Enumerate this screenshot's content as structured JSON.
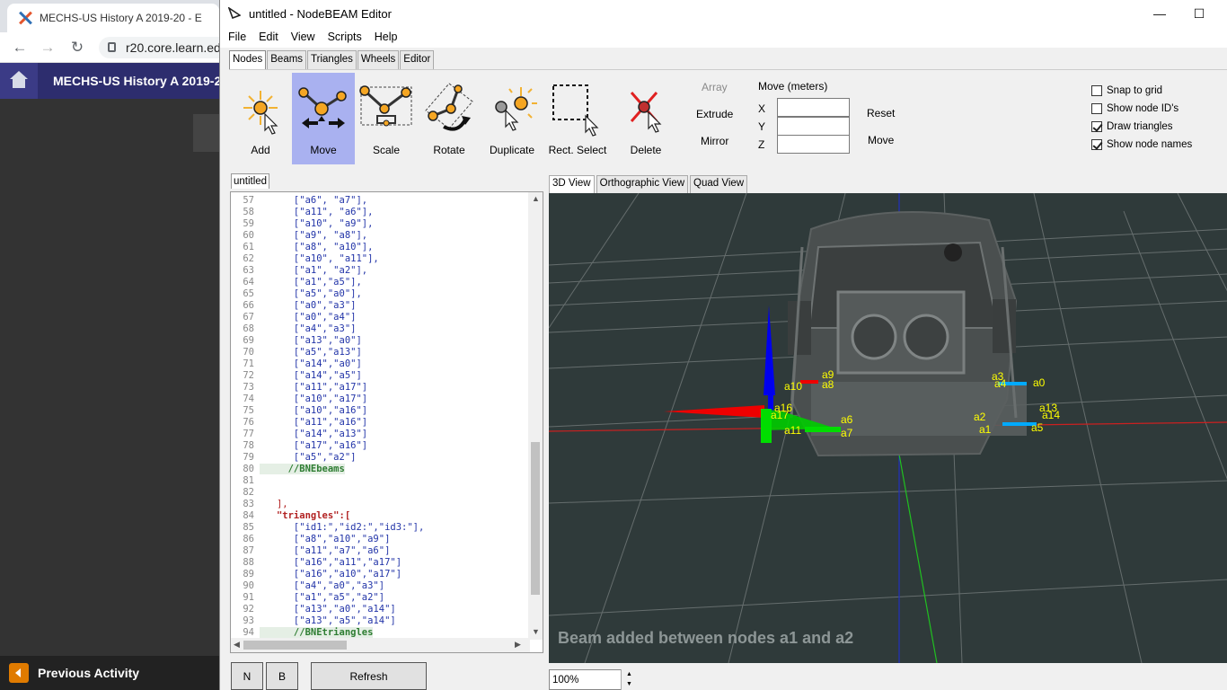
{
  "browser": {
    "tab_title": "MECHS-US History A 2019-20 - E",
    "url": "r20.core.learn.ed",
    "site_title": "MECHS-US History A 2019-20",
    "prev_activity": "Previous Activity"
  },
  "window": {
    "title": "untitled - NodeBEAM Editor",
    "minimize": "—",
    "maximize": "☐"
  },
  "menu": [
    "File",
    "Edit",
    "View",
    "Scripts",
    "Help"
  ],
  "tabs": [
    "Nodes",
    "Beams",
    "Triangles",
    "Wheels",
    "Editor"
  ],
  "tools": [
    {
      "label": "Add",
      "icon": "add-node-icon"
    },
    {
      "label": "Move",
      "icon": "move-node-icon"
    },
    {
      "label": "Scale",
      "icon": "scale-node-icon"
    },
    {
      "label": "Rotate",
      "icon": "rotate-node-icon"
    },
    {
      "label": "Duplicate",
      "icon": "duplicate-node-icon"
    },
    {
      "label": "Rect. Select",
      "icon": "rect-select-icon"
    },
    {
      "label": "Delete",
      "icon": "delete-node-icon"
    }
  ],
  "side_actions": {
    "array": "Array",
    "extrude": "Extrude",
    "mirror": "Mirror"
  },
  "move_panel": {
    "title": "Move (meters)",
    "x_label": "X",
    "y_label": "Y",
    "z_label": "Z",
    "reset": "Reset",
    "move": "Move",
    "x_value": "",
    "y_value": "",
    "z_value": ""
  },
  "options": [
    {
      "label": "Snap to grid",
      "checked": false
    },
    {
      "label": "Show node ID's",
      "checked": false
    },
    {
      "label": "Draw triangles",
      "checked": true
    },
    {
      "label": "Show node names",
      "checked": true
    }
  ],
  "code_tab": "untitled",
  "code_lines": [
    {
      "n": "57",
      "text": "      [\"a6\", \"a7\"],",
      "cls": "c-str"
    },
    {
      "n": "58",
      "text": "      [\"a11\", \"a6\"],",
      "cls": "c-str"
    },
    {
      "n": "59",
      "text": "      [\"a10\", \"a9\"],",
      "cls": "c-str"
    },
    {
      "n": "60",
      "text": "      [\"a9\", \"a8\"],",
      "cls": "c-str"
    },
    {
      "n": "61",
      "text": "      [\"a8\", \"a10\"],",
      "cls": "c-str"
    },
    {
      "n": "62",
      "text": "      [\"a10\", \"a11\"],",
      "cls": "c-str"
    },
    {
      "n": "63",
      "text": "      [\"a1\", \"a2\"],",
      "cls": "c-str"
    },
    {
      "n": "64",
      "text": "      [\"a1\",\"a5\"],",
      "cls": "c-str"
    },
    {
      "n": "65",
      "text": "      [\"a5\",\"a0\"],",
      "cls": "c-str"
    },
    {
      "n": "66",
      "text": "      [\"a0\",\"a3\"]",
      "cls": "c-str"
    },
    {
      "n": "67",
      "text": "      [\"a0\",\"a4\"]",
      "cls": "c-str"
    },
    {
      "n": "68",
      "text": "      [\"a4\",\"a3\"]",
      "cls": "c-str"
    },
    {
      "n": "69",
      "text": "      [\"a13\",\"a0\"]",
      "cls": "c-str"
    },
    {
      "n": "70",
      "text": "      [\"a5\",\"a13\"]",
      "cls": "c-str"
    },
    {
      "n": "71",
      "text": "      [\"a14\",\"a0\"]",
      "cls": "c-str"
    },
    {
      "n": "72",
      "text": "      [\"a14\",\"a5\"]",
      "cls": "c-str"
    },
    {
      "n": "73",
      "text": "      [\"a11\",\"a17\"]",
      "cls": "c-str"
    },
    {
      "n": "74",
      "text": "      [\"a10\",\"a17\"]",
      "cls": "c-str"
    },
    {
      "n": "75",
      "text": "      [\"a10\",\"a16\"]",
      "cls": "c-str"
    },
    {
      "n": "76",
      "text": "      [\"a11\",\"a16\"]",
      "cls": "c-str"
    },
    {
      "n": "77",
      "text": "      [\"a14\",\"a13\"]",
      "cls": "c-str"
    },
    {
      "n": "78",
      "text": "      [\"a17\",\"a16\"]",
      "cls": "c-str"
    },
    {
      "n": "79",
      "text": "      [\"a5\",\"a2\"]",
      "cls": "c-str"
    },
    {
      "n": "80",
      "text": "     //BNEbeams",
      "cls": "c-cmt"
    },
    {
      "n": "81",
      "text": "",
      "cls": ""
    },
    {
      "n": "82",
      "text": "",
      "cls": ""
    },
    {
      "n": "83",
      "text": "   ],",
      "cls": "c-br"
    },
    {
      "n": "84",
      "text": "   \"triangles\":[",
      "cls": "c-key"
    },
    {
      "n": "85",
      "text": "      [\"id1:\",\"id2:\",\"id3:\"],",
      "cls": "c-str"
    },
    {
      "n": "86",
      "text": "      [\"a8\",\"a10\",\"a9\"]",
      "cls": "c-str"
    },
    {
      "n": "87",
      "text": "      [\"a11\",\"a7\",\"a6\"]",
      "cls": "c-str"
    },
    {
      "n": "88",
      "text": "      [\"a16\",\"a11\",\"a17\"]",
      "cls": "c-str"
    },
    {
      "n": "89",
      "text": "      [\"a16\",\"a10\",\"a17\"]",
      "cls": "c-str"
    },
    {
      "n": "90",
      "text": "      [\"a4\",\"a0\",\"a3\"]",
      "cls": "c-str"
    },
    {
      "n": "91",
      "text": "      [\"a1\",\"a5\",\"a2\"]",
      "cls": "c-str"
    },
    {
      "n": "92",
      "text": "      [\"a13\",\"a0\",\"a14\"]",
      "cls": "c-str"
    },
    {
      "n": "93",
      "text": "      [\"a13\",\"a5\",\"a14\"]",
      "cls": "c-str"
    },
    {
      "n": "94",
      "text": "      //BNEtriangles",
      "cls": "c-cmt"
    }
  ],
  "bottom_buttons": {
    "n": "N",
    "b": "B",
    "refresh": "Refresh"
  },
  "view_tabs": [
    "3D View",
    "Orthographic View",
    "Quad View"
  ],
  "viewport": {
    "status": "Beam added between nodes a1 and a2",
    "node_labels": [
      "a9",
      "a10",
      "a8",
      "a3",
      "a4",
      "a0",
      "a16",
      "a17",
      "a6",
      "a2",
      "a13",
      "a14",
      "a11",
      "a7",
      "a1",
      "a5"
    ],
    "axis_colors": {
      "x": "#ff0000",
      "y": "#00ff00",
      "z": "#0000ff"
    },
    "background": "#2f3a3a"
  },
  "zoom": "100%"
}
